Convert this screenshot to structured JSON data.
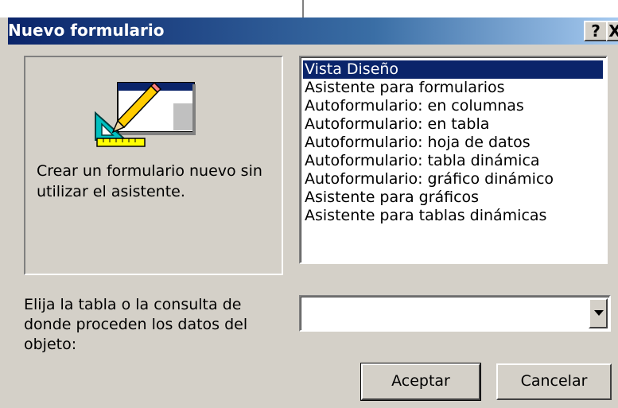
{
  "dialog": {
    "title": "Nuevo formulario",
    "help_label": "?",
    "close_label": "X"
  },
  "preview": {
    "description": "Crear un formulario nuevo sin utilizar el asistente.",
    "icon": "form-design-icon"
  },
  "options": [
    {
      "label": "Vista Diseño",
      "selected": true
    },
    {
      "label": "Asistente para formularios",
      "selected": false
    },
    {
      "label": "Autoformulario: en columnas",
      "selected": false
    },
    {
      "label": "Autoformulario: en tabla",
      "selected": false
    },
    {
      "label": "Autoformulario: hoja de datos",
      "selected": false
    },
    {
      "label": "Autoformulario: tabla dinámica",
      "selected": false
    },
    {
      "label": "Autoformulario: gráfico dinámico",
      "selected": false
    },
    {
      "label": "Asistente para gráficos",
      "selected": false
    },
    {
      "label": "Asistente para tablas dinámicas",
      "selected": false
    }
  ],
  "source": {
    "label": "Elija la tabla o la consulta de donde proceden los datos del objeto:",
    "value": "",
    "dropdown_icon": "chevron-down-icon"
  },
  "buttons": {
    "ok": "Aceptar",
    "cancel": "Cancelar"
  },
  "colors": {
    "titlebar_start": "#0a246a",
    "titlebar_end": "#a6caf0",
    "selection": "#0a246a",
    "face": "#d4d0c8"
  }
}
